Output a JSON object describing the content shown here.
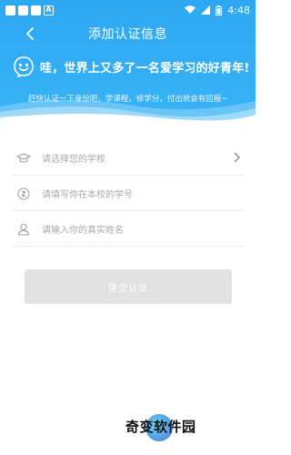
{
  "status_bar": {
    "time": "4:48",
    "app_badge": "A"
  },
  "nav": {
    "title": "添加认证信息"
  },
  "banner": {
    "headline": "哇，世界上又多了一名爱学习的好青年!",
    "subtitle": "赶快认证一下身份吧，学课程，修学分，付出就会有回报~"
  },
  "form": {
    "school": {
      "placeholder": "请选择您的学校",
      "icon": "graduation-cap-icon"
    },
    "student_id": {
      "placeholder": "请填写你在本校的学号",
      "icon": "coin-icon"
    },
    "real_name": {
      "placeholder": "请输入你的真实姓名",
      "icon": "person-icon"
    }
  },
  "submit": {
    "label": "提交认证"
  },
  "watermark": {
    "text": "奇变软件园"
  },
  "colors": {
    "header": "#33aef4",
    "button_disabled": "#e2e2e2"
  }
}
